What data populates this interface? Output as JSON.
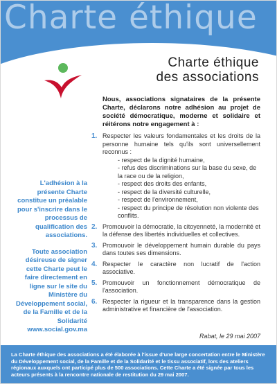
{
  "banner": {
    "title": "Charte éthique"
  },
  "heading": {
    "line1": "Charte éthique",
    "line2": "des associations"
  },
  "intro": "Nous, associations signataires de la présente Charte, déclarons notre adhésion au projet de société démocratique, moderne et solidaire et réitérons notre engagement à :",
  "articles": [
    {
      "num": "1.",
      "text": "Respecter les valeurs fondamentales et les droits de la personne humaine tels qu'ils sont universellement reconnus :",
      "subitems": [
        "- respect de la dignité humaine,",
        "- refus des discriminations sur la base du sexe, de la race ou de la religion,",
        "- respect des droits des enfants,",
        "- respect de la diversité culturelle,",
        "- respect de l'environnement,",
        "- respect du principe de résolution non violente des conflits."
      ]
    },
    {
      "num": "2.",
      "text": "Promouvoir la démocratie, la citoyenneté, la modernité et la défense des libertés individuelles et collectives."
    },
    {
      "num": "3.",
      "text": "Promouvoir le développement humain durable du pays dans toutes ses dimensions."
    },
    {
      "num": "4.",
      "text": "Respecter le caractère non lucratif de l'action associative."
    },
    {
      "num": "5.",
      "text": "Promouvoir un fonctionnement démocratique de l'association."
    },
    {
      "num": "6.",
      "text": "Respecter la rigueur et la transparence dans la gestion administrative et financière de l'association."
    }
  ],
  "sidebar": {
    "para1": "L'adhésion à la présente Charte constitue un préalable pour s'inscrire dans le processus de qualification des associations.",
    "para2": "Toute association désireuse de signer cette Charte peut le faire directement en ligne sur le site du Ministère du Développement social, de la Famille et de la Solidarité www.social.gov.ma"
  },
  "signature": "Rabat, le 29 mai 2007",
  "footer": "La Charte éthique des associations a été élaborée à l'issue d'une large concertation entre le Ministère du Développement social, de la Famille et de la Solidarité et le tissu associatif, lors des ateliers régionaux auxquels ont participé plus de 500 associations. Cette Charte a été signée par tous les acteurs présents à la rencontre nationale de restitution du 29 mai 2007.",
  "colors": {
    "brand_blue": "#4a8fd0",
    "logo_red": "#c8102e",
    "logo_green": "#5cb85c"
  },
  "icons": {
    "logo": "stylized-person-logo"
  }
}
